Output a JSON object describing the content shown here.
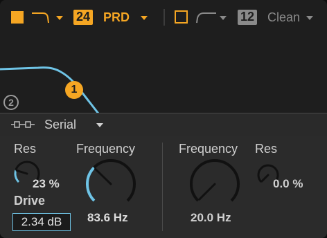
{
  "colors": {
    "filter1": "#f5a623",
    "filter2_inactive": "#8a8a8a",
    "accent": "#6fc4e6",
    "knob_track": "#111111"
  },
  "toolbar": {
    "filter1_enable_icon": "square-filled-icon",
    "filter1_type_icon": "lowpass-curve-icon",
    "filter1_slope": "24",
    "filter1_circuit": "PRD",
    "filter2_enable_icon": "square-outline-icon",
    "filter2_type_icon": "highpass-curve-icon",
    "filter2_slope": "12",
    "filter2_circuit": "Clean"
  },
  "graph": {
    "node1_label": "1",
    "node2_label": "2"
  },
  "routing": {
    "icon": "serial-routing-icon",
    "value": "Serial"
  },
  "filter1": {
    "res_label": "Res",
    "res_value": "23 %",
    "res_level": 0.23,
    "drive_label": "Drive",
    "drive_value": "2.34 dB",
    "freq_label": "Frequency",
    "freq_value": "83.6 Hz",
    "freq_level": 0.33
  },
  "filter2": {
    "freq_label": "Frequency",
    "freq_value": "20.0 Hz",
    "freq_level": 0.0,
    "res_label": "Res",
    "res_value": "0.0 %",
    "res_level": 0.0
  }
}
